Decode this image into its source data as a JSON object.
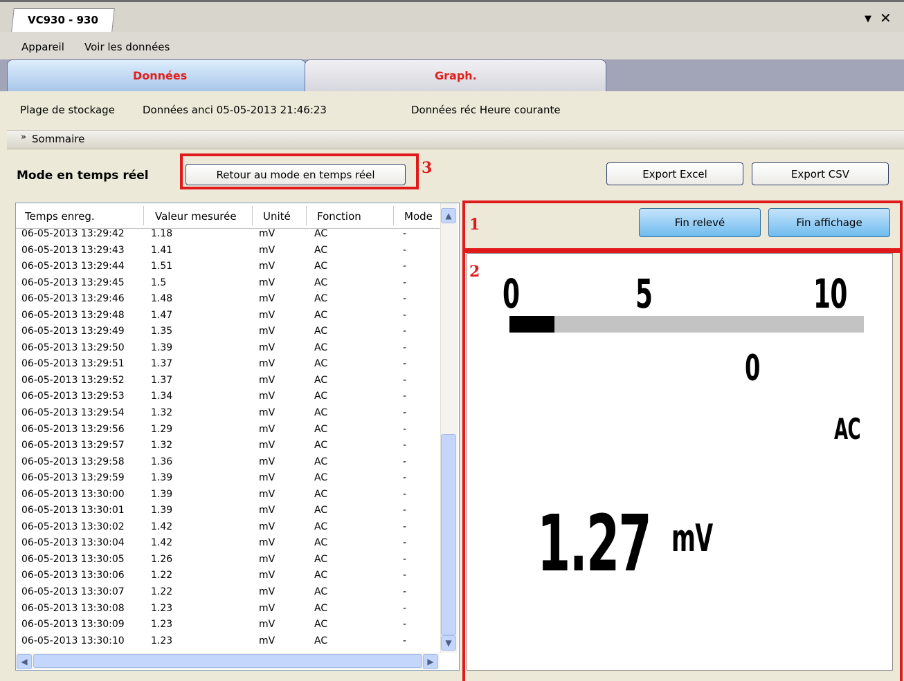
{
  "window": {
    "tab_title": "VC930 - 930",
    "dropdown_icon": "dropdown-arrow-icon",
    "close_icon": "close-icon"
  },
  "menu": {
    "items": [
      "Appareil",
      "Voir les données"
    ]
  },
  "view_tabs": [
    {
      "label": "Données",
      "active": true
    },
    {
      "label": "Graph.",
      "active": false
    }
  ],
  "storage": {
    "range_label": "Plage de stockage",
    "old_data": "Données anci 05-05-2013 21:46:23",
    "recent_data": "Données réc Heure courante"
  },
  "summary": {
    "label": "Sommaire",
    "icon": "double-chevron-down-icon"
  },
  "realtime": {
    "title": "Mode en temps réel",
    "back_button": "Retour au mode en temps réel"
  },
  "export": {
    "excel": "Export Excel",
    "csv": "Export CSV"
  },
  "controls": {
    "stop_recording": "Fin relevé",
    "stop_display": "Fin affichage"
  },
  "annotations": [
    "1",
    "2",
    "3"
  ],
  "table": {
    "columns": [
      "Temps enreg.",
      "Valeur mesurée",
      "Unité",
      "Fonction",
      "Mode"
    ],
    "rows": [
      [
        "06-05-2013 13:29:42",
        "1.18",
        "mV",
        "AC",
        "-"
      ],
      [
        "06-05-2013 13:29:43",
        "1.41",
        "mV",
        "AC",
        "-"
      ],
      [
        "06-05-2013 13:29:44",
        "1.51",
        "mV",
        "AC",
        "-"
      ],
      [
        "06-05-2013 13:29:45",
        "1.5",
        "mV",
        "AC",
        "-"
      ],
      [
        "06-05-2013 13:29:46",
        "1.48",
        "mV",
        "AC",
        "-"
      ],
      [
        "06-05-2013 13:29:48",
        "1.47",
        "mV",
        "AC",
        "-"
      ],
      [
        "06-05-2013 13:29:49",
        "1.35",
        "mV",
        "AC",
        "-"
      ],
      [
        "06-05-2013 13:29:50",
        "1.39",
        "mV",
        "AC",
        "-"
      ],
      [
        "06-05-2013 13:29:51",
        "1.37",
        "mV",
        "AC",
        "-"
      ],
      [
        "06-05-2013 13:29:52",
        "1.37",
        "mV",
        "AC",
        "-"
      ],
      [
        "06-05-2013 13:29:53",
        "1.34",
        "mV",
        "AC",
        "-"
      ],
      [
        "06-05-2013 13:29:54",
        "1.32",
        "mV",
        "AC",
        "-"
      ],
      [
        "06-05-2013 13:29:56",
        "1.29",
        "mV",
        "AC",
        "-"
      ],
      [
        "06-05-2013 13:29:57",
        "1.32",
        "mV",
        "AC",
        "-"
      ],
      [
        "06-05-2013 13:29:58",
        "1.36",
        "mV",
        "AC",
        "-"
      ],
      [
        "06-05-2013 13:29:59",
        "1.39",
        "mV",
        "AC",
        "-"
      ],
      [
        "06-05-2013 13:30:00",
        "1.39",
        "mV",
        "AC",
        "-"
      ],
      [
        "06-05-2013 13:30:01",
        "1.39",
        "mV",
        "AC",
        "-"
      ],
      [
        "06-05-2013 13:30:02",
        "1.42",
        "mV",
        "AC",
        "-"
      ],
      [
        "06-05-2013 13:30:04",
        "1.42",
        "mV",
        "AC",
        "-"
      ],
      [
        "06-05-2013 13:30:05",
        "1.26",
        "mV",
        "AC",
        "-"
      ],
      [
        "06-05-2013 13:30:06",
        "1.22",
        "mV",
        "AC",
        "-"
      ],
      [
        "06-05-2013 13:30:07",
        "1.22",
        "mV",
        "AC",
        "-"
      ],
      [
        "06-05-2013 13:30:08",
        "1.23",
        "mV",
        "AC",
        "-"
      ],
      [
        "06-05-2013 13:30:09",
        "1.23",
        "mV",
        "AC",
        "-"
      ],
      [
        "06-05-2013 13:30:10",
        "1.23",
        "mV",
        "AC",
        "-"
      ]
    ]
  },
  "display": {
    "scale_labels": [
      "0",
      "5",
      "10"
    ],
    "bar_fraction": 0.127,
    "range_indicator": "0",
    "function": "AC",
    "value": "1.27",
    "unit": "mV"
  },
  "colors": {
    "tab_label": "#e0201d",
    "annotation_red": "#e01a1a",
    "button_blue": "#6fbbef",
    "scroll_blue": "#c4d6fb"
  }
}
